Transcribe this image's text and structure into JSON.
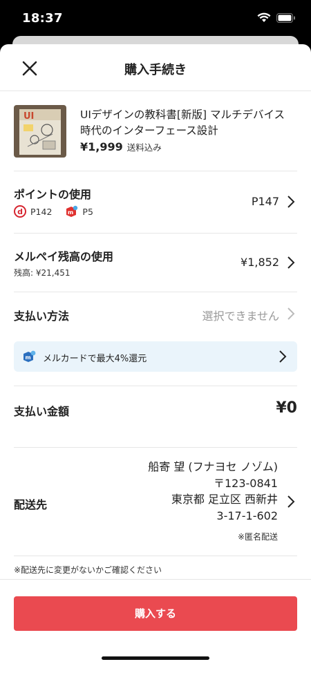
{
  "status_bar": {
    "time": "18:37"
  },
  "header": {
    "title": "購入手続き"
  },
  "product": {
    "title": "UIデザインの教科書[新版] マルチデバイス時代のインターフェース設計",
    "price": "¥1,999",
    "shipping": "送料込み",
    "thumb_text": "UI"
  },
  "points": {
    "label": "ポイントの使用",
    "items": [
      {
        "icon": "d-point-icon",
        "value": "P142"
      },
      {
        "icon": "mercari-point-icon",
        "value": "P5"
      }
    ],
    "value": "P147"
  },
  "balance": {
    "label": "メルペイ残高の使用",
    "sub": "残高: ¥21,451",
    "value": "¥1,852"
  },
  "payment": {
    "label": "支払い方法",
    "value": "選択できません"
  },
  "banner": {
    "text": "メルカードで最大4%還元",
    "color": "#eaf4fb"
  },
  "total": {
    "label": "支払い金額",
    "value": "¥0"
  },
  "shipping_address": {
    "label": "配送先",
    "name": "船寄 望 (フナヨセ ノゾム)",
    "postal": "〒123-0841",
    "line1": "東京都 足立区 西新井",
    "line2": "3-17-1-602",
    "note": "※匿名配送"
  },
  "notice": "※配送先に変更がないかご確認ください",
  "purchase_button": {
    "label": "購入する",
    "color": "#ea4a50"
  }
}
